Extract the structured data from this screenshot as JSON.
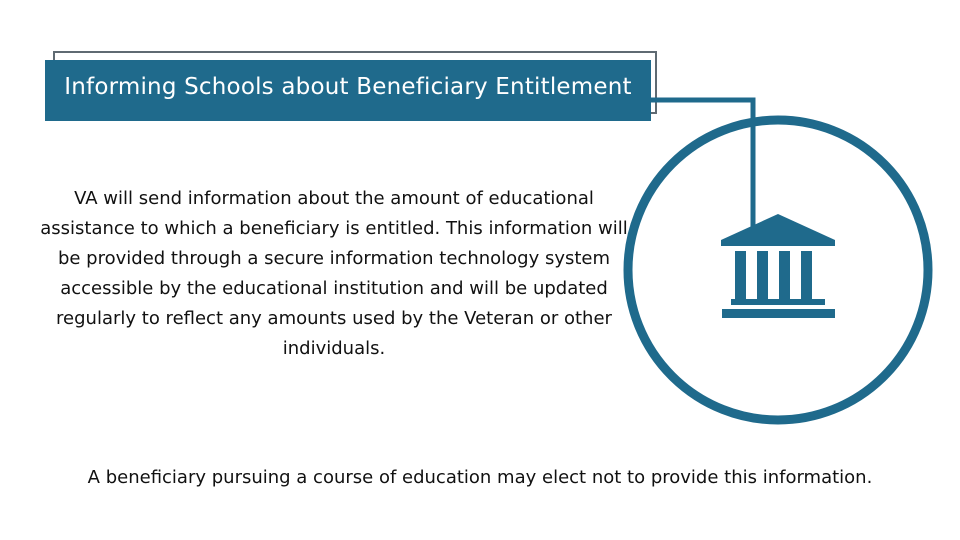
{
  "title": "Informing Schools about Beneficiary Entitlement",
  "body_text": "VA will send information about the amount of educational assistance to which a beneficiary is entitled. This information will be provided through a secure information technology system accessible by the educational institution and will be updated regularly to reflect any amounts used by the Veteran or other individuals.",
  "footer_text": "A beneficiary pursuing a course of education may elect not to provide this information.",
  "icon": {
    "name": "bank-building-icon"
  },
  "colors": {
    "accent": "#1f6a8c",
    "outline": "#5f6a72",
    "text": "#111111"
  }
}
